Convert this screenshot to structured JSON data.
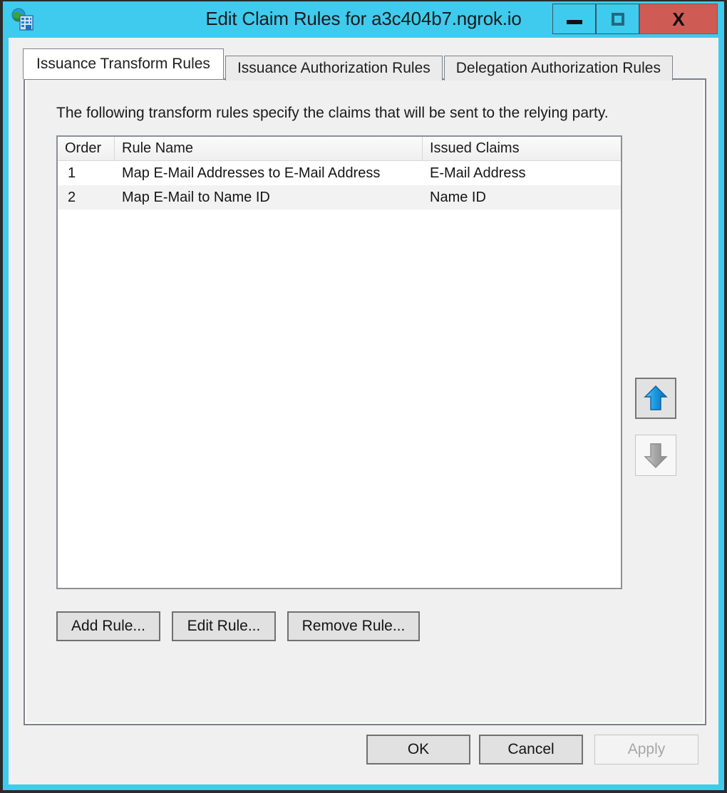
{
  "window": {
    "title": "Edit Claim Rules for a3c404b7.ngrok.io",
    "app_icon": "adfs-relying-party-icon",
    "accent_color": "#3fcbee",
    "close_color": "#cf5b55",
    "controls": {
      "minimize": "minimize-icon",
      "maximize": "maximize-icon",
      "close": "X"
    }
  },
  "tabs": [
    {
      "label": "Issuance Transform Rules",
      "active": true
    },
    {
      "label": "Issuance Authorization Rules",
      "active": false
    },
    {
      "label": "Delegation Authorization Rules",
      "active": false
    }
  ],
  "panel": {
    "description": "The following transform rules specify the claims that will be sent to the relying party."
  },
  "list": {
    "columns": [
      "Order",
      "Rule Name",
      "Issued Claims"
    ],
    "rows": [
      {
        "order": "1",
        "rule_name": "Map E-Mail Addresses to E-Mail Address",
        "issued_claims": "E-Mail Address"
      },
      {
        "order": "2",
        "rule_name": "Map E-Mail to Name ID",
        "issued_claims": "Name ID"
      }
    ]
  },
  "order_buttons": {
    "move_up": "arrow-up-icon",
    "move_down": "arrow-down-icon",
    "move_up_enabled": true,
    "move_down_enabled": false
  },
  "rule_buttons": {
    "add": "Add Rule...",
    "edit": "Edit Rule...",
    "remove": "Remove Rule..."
  },
  "footer": {
    "ok": "OK",
    "cancel": "Cancel",
    "apply": "Apply",
    "apply_enabled": false
  }
}
